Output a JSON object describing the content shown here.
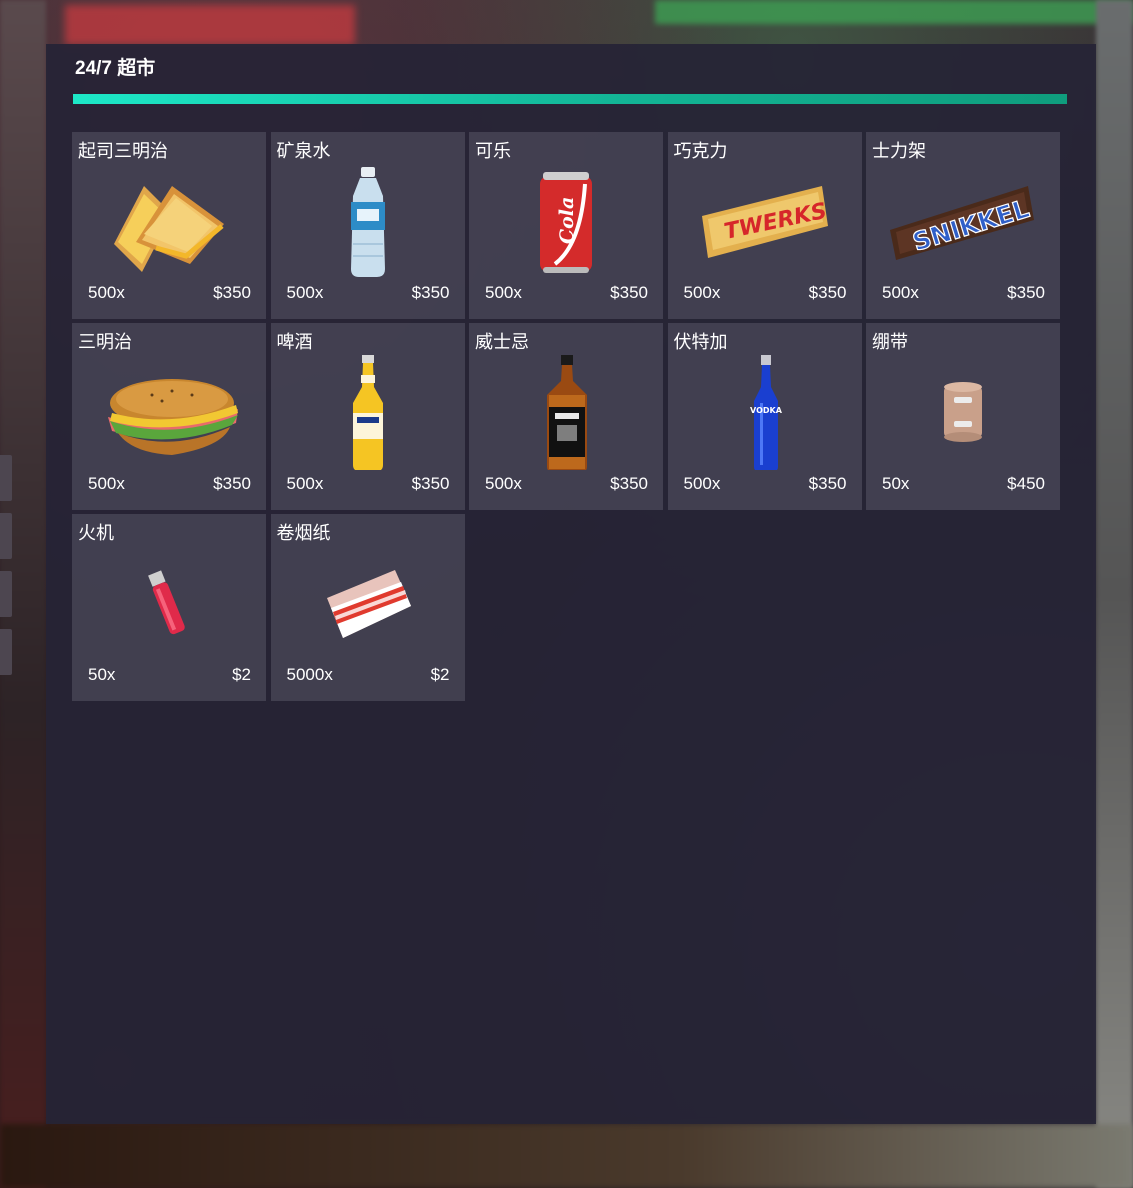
{
  "shop": {
    "title": "24/7 超市",
    "accent_color": "#1de8c8"
  },
  "items": [
    {
      "name": "起司三明治",
      "qty": "500x",
      "price": "$350",
      "icon": "grilled-cheese-icon"
    },
    {
      "name": "矿泉水",
      "qty": "500x",
      "price": "$350",
      "icon": "water-bottle-icon"
    },
    {
      "name": "可乐",
      "qty": "500x",
      "price": "$350",
      "icon": "cola-can-icon",
      "label": "Cola"
    },
    {
      "name": "巧克力",
      "qty": "500x",
      "price": "$350",
      "icon": "chocolate-bar-icon",
      "label": "TWERKS"
    },
    {
      "name": "士力架",
      "qty": "500x",
      "price": "$350",
      "icon": "snack-bar-icon",
      "label": "SNIKKEL"
    },
    {
      "name": "三明治",
      "qty": "500x",
      "price": "$350",
      "icon": "sub-sandwich-icon"
    },
    {
      "name": "啤酒",
      "qty": "500x",
      "price": "$350",
      "icon": "beer-bottle-icon"
    },
    {
      "name": "威士忌",
      "qty": "500x",
      "price": "$350",
      "icon": "whiskey-bottle-icon"
    },
    {
      "name": "伏特加",
      "qty": "500x",
      "price": "$350",
      "icon": "vodka-bottle-icon",
      "label": "VODKA"
    },
    {
      "name": "绷带",
      "qty": "50x",
      "price": "$450",
      "icon": "bandage-roll-icon"
    },
    {
      "name": "火机",
      "qty": "50x",
      "price": "$2",
      "icon": "lighter-icon"
    },
    {
      "name": "卷烟纸",
      "qty": "5000x",
      "price": "$2",
      "icon": "rolling-papers-icon"
    }
  ]
}
